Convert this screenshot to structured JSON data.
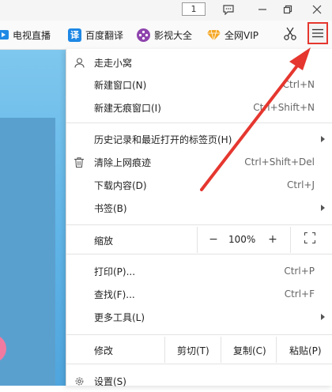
{
  "titlebar": {
    "tab_count": "1"
  },
  "bookmarks": [
    {
      "label": "电视直播"
    },
    {
      "label": "百度翻译",
      "icon_text": "译"
    },
    {
      "label": "影视大全"
    },
    {
      "label": "全网VIP"
    }
  ],
  "menu": {
    "items": [
      {
        "label": "走走小窝"
      },
      {
        "label": "新建窗口(N)",
        "shortcut": "Ctrl+N"
      },
      {
        "label": "新建无痕窗口(I)",
        "shortcut": "Ctrl+Shift+N"
      },
      {
        "label": "历史记录和最近打开的标签页(H)"
      },
      {
        "label": "清除上网痕迹",
        "shortcut": "Ctrl+Shift+Del"
      },
      {
        "label": "下载内容(D)",
        "shortcut": "Ctrl+J"
      },
      {
        "label": "书签(B)"
      },
      {
        "label": "打印(P)...",
        "shortcut": "Ctrl+P"
      },
      {
        "label": "查找(F)...",
        "shortcut": "Ctrl+F"
      },
      {
        "label": "更多工具(L)"
      },
      {
        "label": "设置(S)"
      }
    ],
    "zoom": {
      "label": "缩放",
      "minus": "−",
      "value": "100%",
      "plus": "+"
    },
    "edit": {
      "label": "修改",
      "cut": "剪切(T)",
      "copy": "复制(C)",
      "paste": "粘贴(P)"
    }
  },
  "colors": {
    "highlight": "#e5372f",
    "accent_blue": "#1e88e5"
  }
}
